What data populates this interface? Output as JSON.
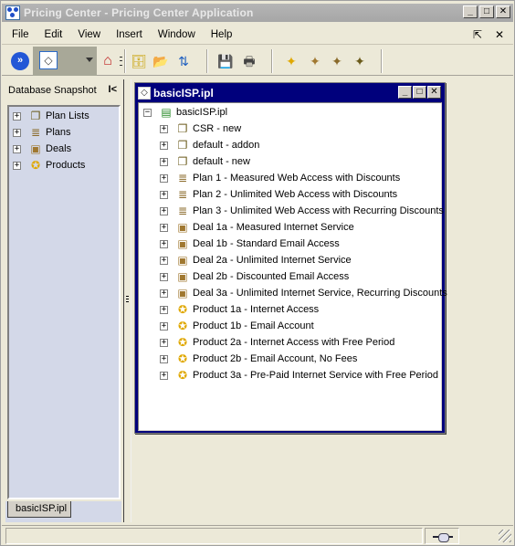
{
  "window": {
    "title": "Pricing Center - Pricing Center Application",
    "buttons": {
      "minimize": "_",
      "maximize": "□",
      "close": "✕"
    }
  },
  "menubar": {
    "items": [
      {
        "label": "File",
        "mnemonic": "F"
      },
      {
        "label": "Edit",
        "mnemonic": "E"
      },
      {
        "label": "View",
        "mnemonic": "V"
      },
      {
        "label": "Insert",
        "mnemonic": "I"
      },
      {
        "label": "Window",
        "mnemonic": "W"
      },
      {
        "label": "Help",
        "mnemonic": "H"
      }
    ],
    "right": {
      "detach": "⇱",
      "close": "✕"
    }
  },
  "toolbar": {
    "buttons": [
      {
        "name": "navigator-chevron",
        "glyph": "»"
      },
      {
        "name": "tag-combo",
        "glyph": "◇"
      },
      {
        "name": "home",
        "glyph": "⌂"
      },
      {
        "name": "new-database",
        "glyph": "🗄"
      },
      {
        "name": "open",
        "glyph": "📂"
      },
      {
        "name": "import",
        "glyph": "⇅"
      },
      {
        "name": "save",
        "glyph": "💾"
      },
      {
        "name": "print",
        "glyph": "🖶"
      },
      {
        "name": "new-product",
        "glyph": "✦"
      },
      {
        "name": "new-deal",
        "glyph": "✦"
      },
      {
        "name": "new-plan",
        "glyph": "✦"
      },
      {
        "name": "new-plan-list",
        "glyph": "✦"
      }
    ]
  },
  "left_panel": {
    "title": "Database Snapshot",
    "collapse_glyph": "I<",
    "tree": [
      {
        "label": "Plan Lists",
        "type": "plan-list",
        "expander": "+"
      },
      {
        "label": "Plans",
        "type": "plan",
        "expander": "+"
      },
      {
        "label": "Deals",
        "type": "deal",
        "expander": "+"
      },
      {
        "label": "Products",
        "type": "product",
        "expander": "+"
      }
    ],
    "tab": "basicISP.ipl"
  },
  "document_window": {
    "title": "basicISP.ipl",
    "root": {
      "label": "basicISP.ipl",
      "expander": "−"
    },
    "items": [
      {
        "label": "CSR - new",
        "type": "plan-list"
      },
      {
        "label": "default - addon",
        "type": "plan-list"
      },
      {
        "label": "default - new",
        "type": "plan-list"
      },
      {
        "label": "Plan 1 - Measured Web Access with Discounts",
        "type": "plan"
      },
      {
        "label": "Plan 2 - Unlimited Web Access with Discounts",
        "type": "plan"
      },
      {
        "label": "Plan 3 - Unlimited Web Access with Recurring Discounts",
        "type": "plan"
      },
      {
        "label": "Deal 1a - Measured Internet Service",
        "type": "deal"
      },
      {
        "label": "Deal 1b - Standard Email Access",
        "type": "deal"
      },
      {
        "label": "Deal 2a - Unlimited Internet Service",
        "type": "deal"
      },
      {
        "label": "Deal 2b - Discounted Email Access",
        "type": "deal"
      },
      {
        "label": "Deal 3a - Unlimited Internet Service, Recurring Discounts",
        "type": "deal"
      },
      {
        "label": "Product 1a - Internet Access",
        "type": "product"
      },
      {
        "label": "Product 1b - Email Account",
        "type": "product"
      },
      {
        "label": "Product 2a - Internet Access with Free Period",
        "type": "product"
      },
      {
        "label": "Product 2b - Email Account, No Fees",
        "type": "product"
      },
      {
        "label": "Product 3a - Pre-Paid Internet Service with Free Period",
        "type": "product"
      }
    ]
  },
  "statusbar": {
    "message": "",
    "connection_icon": "connected"
  },
  "icons": {
    "plan-list": "❐",
    "plan": "≣",
    "deal": "▣",
    "product": "✪",
    "database": "▤"
  },
  "colors": {
    "inner_title_bg": "#00007c",
    "app_bg": "#ece9d8",
    "tree_panel_bg": "#d3d8e8",
    "inactive_title": "#a6a6a6"
  }
}
